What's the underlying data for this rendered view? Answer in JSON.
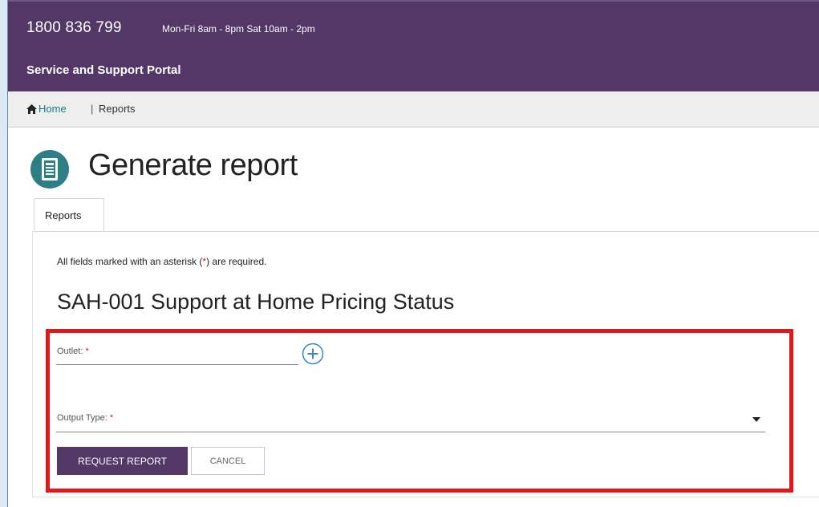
{
  "header": {
    "phone": "1800 836 799",
    "hours": "Mon-Fri 8am - 8pm Sat 10am - 2pm",
    "portal_title": "Service and Support Portal"
  },
  "breadcrumb": {
    "home": "Home",
    "separator": "|",
    "current": "Reports"
  },
  "page": {
    "title": "Generate report",
    "tab": "Reports"
  },
  "form": {
    "required_note_prefix": "All fields marked with an asterisk (",
    "required_note_star": "*",
    "required_note_suffix": ") are required.",
    "report_title": "SAH-001 Support at Home Pricing Status",
    "outlet_label": "Outlet:",
    "output_type_label": "Output Type:",
    "required_marker": "*",
    "request_button": "REQUEST REPORT",
    "cancel_button": "CANCEL"
  },
  "colors": {
    "brand_purple": "#533867",
    "icon_teal": "#2d7f86",
    "highlight_red": "#e4161d",
    "required_red": "#d01e1e"
  },
  "icons": {
    "breadcrumb": "home-icon",
    "page": "report-icon",
    "add": "add-circle-icon",
    "dropdown": "caret-down-icon"
  }
}
